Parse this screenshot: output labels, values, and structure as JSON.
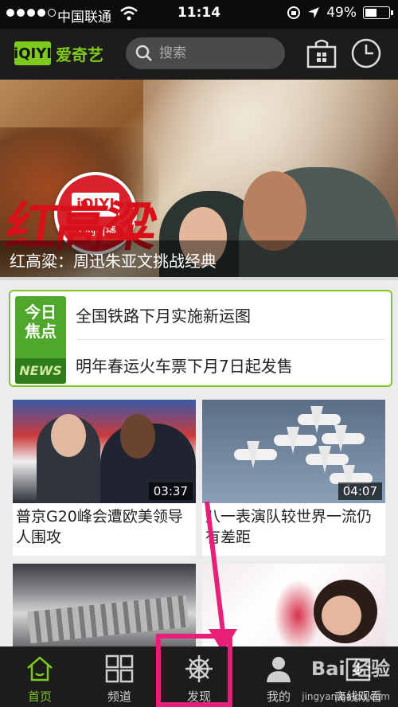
{
  "status_bar": {
    "carrier": "中国联通",
    "time": "11:14",
    "battery": "49%",
    "battery_level": 0.49
  },
  "header": {
    "logo_mark": "iQIYI",
    "logo_text": "爱奇艺",
    "search_placeholder": "搜索",
    "icons": [
      "search-icon",
      "bag-icon",
      "clock-icon"
    ]
  },
  "banner": {
    "badge_mark": "iQIYI",
    "badge_text": "全网首播",
    "calligraphy": "红高粱",
    "caption": "红高粱：周迅朱亚文挑战经典"
  },
  "hot_topics": {
    "badge_top": "今日",
    "badge_mid": "焦点",
    "badge_bottom": "NEWS",
    "items": [
      "全国铁路下月实施新运图",
      "明年春运火车票下月7日起发售"
    ]
  },
  "videos": [
    {
      "title": "普京G20峰会遭欧美领导人围攻",
      "duration": "03:37"
    },
    {
      "title": "八一表演队较世界一流仍有差距",
      "duration": "04:07"
    },
    {
      "title": "",
      "duration": ""
    },
    {
      "title": "",
      "duration": ""
    }
  ],
  "tabs": [
    {
      "label": "首页",
      "icon": "home-icon",
      "active": true
    },
    {
      "label": "频道",
      "icon": "grid-icon",
      "active": false
    },
    {
      "label": "发现",
      "icon": "helm-icon",
      "active": false
    },
    {
      "label": "我的",
      "icon": "user-icon",
      "active": false
    },
    {
      "label": "离线观看",
      "icon": "download-icon",
      "active": false
    }
  ],
  "watermark": {
    "brand": "Bai 经验",
    "url": "jingyan.baidu.com"
  },
  "colors": {
    "accent": "#7ec91e",
    "annotation": "#e81f78",
    "header_bg": "#1c1c1c"
  }
}
